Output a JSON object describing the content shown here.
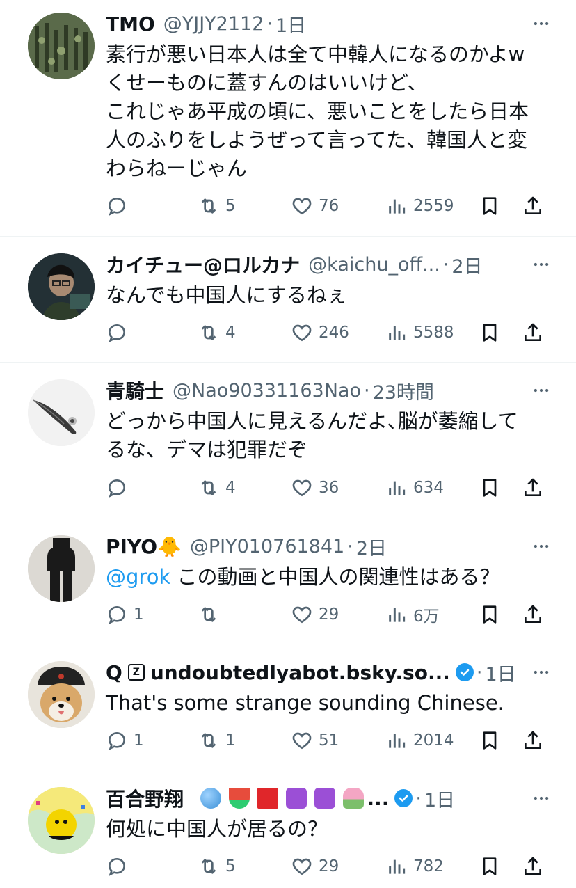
{
  "tweets": [
    {
      "name": "TMO",
      "handle": "@YJJY2112",
      "time": "1日",
      "text": "素行が悪い日本人は全て中韓人になるのかよw\nくせーものに蓋すんのはいいけど、\nこれじゃあ平成の頃に、悪いことをしたら日本\n人のふりをしようぜって言ってた、韓国人と変\nわらねーじゃん",
      "reply_count": "",
      "retweet_count": "5",
      "like_count": "76",
      "view_count": "2559"
    },
    {
      "name": "カイチュー@ロルカナ",
      "handle": "@kaichu_off...",
      "time": "2日",
      "text": "なんでも中国人にするねぇ",
      "reply_count": "",
      "retweet_count": "4",
      "like_count": "246",
      "view_count": "5588"
    },
    {
      "name": "青騎士",
      "handle": "@Nao90331163Nao",
      "time": "23時間",
      "text": "どっから中国人に見えるんだよ､脳が萎縮して\nるな、デマは犯罪だぞ",
      "reply_count": "",
      "retweet_count": "4",
      "like_count": "36",
      "view_count": "634"
    },
    {
      "name": "PIYO🐥",
      "handle": "@PIY010761841",
      "time": "2日",
      "mention": "@grok",
      "text": " この動画と中国人の関連性はある？",
      "reply_count": "1",
      "retweet_count": "",
      "like_count": "29",
      "view_count": "6万"
    },
    {
      "name": "Q",
      "name_box": "Z",
      "handle_bold": "undoubtedlyabot.bsky.so...",
      "time": "1日",
      "text": "That's some strange sounding Chinese.",
      "reply_count": "1",
      "retweet_count": "1",
      "like_count": "51",
      "view_count": "2014"
    },
    {
      "name": "百合野翔",
      "name_suffix": "...",
      "time": "1日",
      "text": "何処に中国人が居るの？",
      "reply_count": "",
      "retweet_count": "5",
      "like_count": "29",
      "view_count": "782"
    }
  ],
  "icons": {
    "reply": "reply-icon",
    "retweet": "retweet-icon",
    "like": "heart-icon",
    "views": "views-icon",
    "bookmark": "bookmark-icon",
    "share": "share-icon",
    "more": "more-icon",
    "verified": "verified-badge-icon"
  },
  "colors": {
    "text": "#0f1419",
    "secondary": "#536471",
    "link": "#1d9bf0",
    "divider": "#eff3f4"
  }
}
